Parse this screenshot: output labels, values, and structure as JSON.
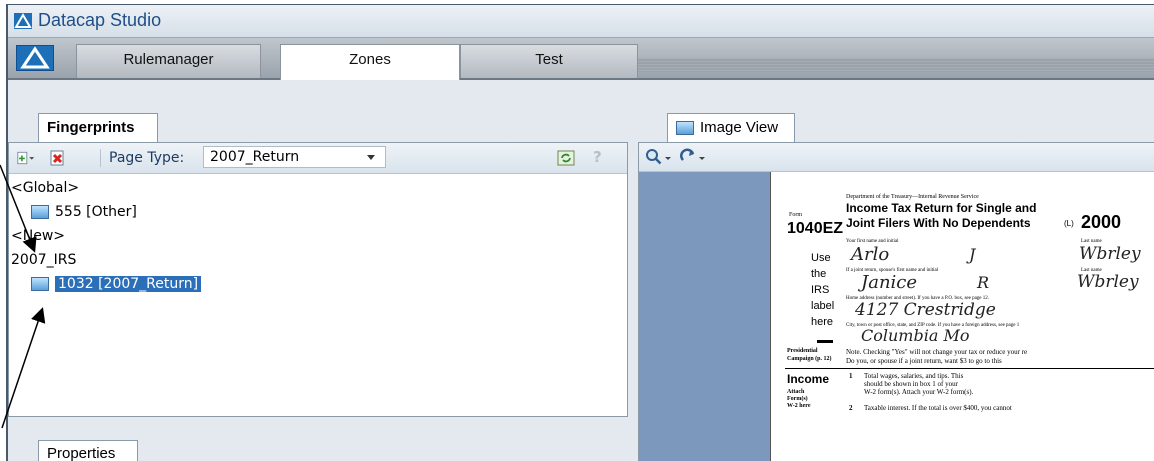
{
  "app": {
    "title": "Datacap Studio"
  },
  "tabs": [
    {
      "label": "Rulemanager",
      "active": false
    },
    {
      "label": "Zones",
      "active": true
    },
    {
      "label": "Test",
      "active": false
    }
  ],
  "fingerprints": {
    "tab_label": "Fingerprints",
    "page_type_label": "Page Type:",
    "page_type_value": "2007_Return",
    "tree": {
      "global": "<Global>",
      "global_child": "555 [Other]",
      "new": "<New>",
      "group": "2007_IRS",
      "group_child": "1032 [2007_Return]"
    }
  },
  "properties": {
    "tab_label": "Properties"
  },
  "image_view": {
    "tab_label": "Image View",
    "document": {
      "dept": "Department of the Treasury—Internal Revenue Service",
      "form_label": "Form",
      "form_number": "1040EZ",
      "title1": "Income Tax Return for Single and",
      "title2": "Joint Filers With No Dependents",
      "omb": "(L)",
      "year": "2000",
      "first_name_label": "Your first name and initial",
      "last_name_label": "Last name",
      "first_name": "Arlo",
      "initial1": "J",
      "last_name": "Wbrley",
      "spouse_label": "If a joint return, spouse's first name and initial",
      "last_name_label2": "Last name",
      "spouse_name": "Janice",
      "initial2": "R",
      "spouse_last": "Wbrley",
      "address_label": "Home address (number and street). If you have a P.O. box, see page 12.",
      "address": "4127 Crestridge",
      "city_label": "City, town or post office, state, and ZIP code. If you have a foreign address, see page 1",
      "city": "Columbia Mo",
      "use_lines": [
        "Use",
        "the",
        "IRS",
        "label",
        "here"
      ],
      "pres_label1": "Presidential",
      "pres_label2": "Campaign (p. 12)",
      "note1": "Note. Checking \"Yes\" will not change your tax or reduce your re",
      "note2": "Do you, or spouse if a joint return, want $3 to go to this",
      "income": "Income",
      "attach1": "Attach",
      "attach2": "Form(s)",
      "attach3": "W-2 here",
      "line1_num": "1",
      "line1a": "Total wages, salaries, and tips. This",
      "line1b": "should be shown in box 1 of your",
      "line1c": "W-2 form(s). Attach your W-2 form(s).",
      "line2_num": "2",
      "line2a": "Taxable interest. If the total is over $400, you cannot"
    }
  },
  "icons": [
    "datacap-logo-icon",
    "add-icon",
    "delete-icon",
    "refresh-icon",
    "help-icon",
    "image-icon",
    "zoom-icon",
    "rotate-icon"
  ]
}
